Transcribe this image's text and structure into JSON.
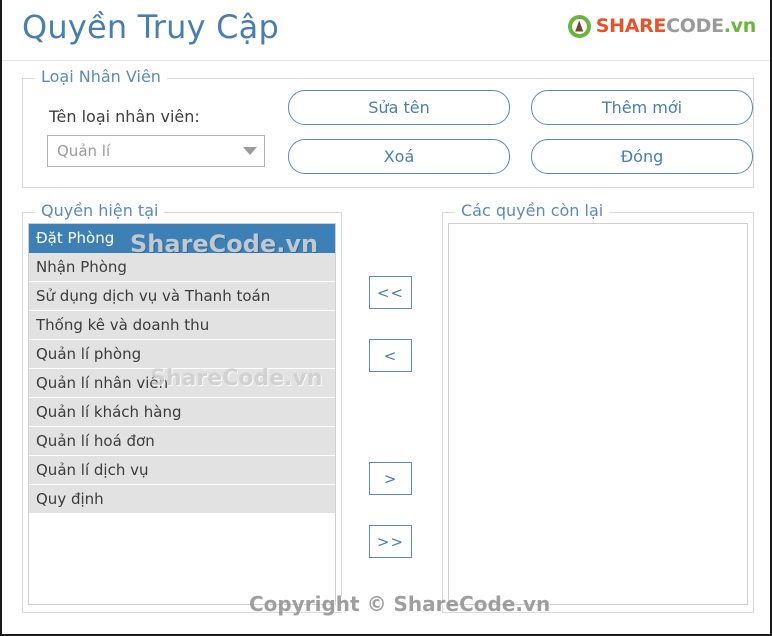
{
  "window": {
    "title": "Quyền Truy Cập"
  },
  "logo": {
    "mark": "sharecode-leaf-icon",
    "share": "SHARE",
    "code": "CODE",
    "vn": ".vn",
    "green": "#6cb33f",
    "orange": "#e8532b",
    "gray": "#9a9a9a"
  },
  "employee_type_group": {
    "legend": "Loại Nhân Viên",
    "label": "Tên loại nhân viên:",
    "combo": {
      "value": "Quản lí",
      "arrow": "chevron-down-icon"
    },
    "buttons": {
      "edit_name": "Sửa tên",
      "add_new": "Thêm mới",
      "delete": "Xoá",
      "close": "Đóng"
    }
  },
  "current_permissions": {
    "legend": "Quyền hiện tại",
    "selected_index": 0,
    "items": [
      "Đặt Phòng",
      "Nhận Phòng",
      "Sử dụng dịch vụ và Thanh toán",
      "Thống kê và doanh thu",
      "Quản lí phòng",
      "Quản lí nhân viên",
      "Quản lí khách hàng",
      "Quản lí hoá đơn",
      "Quản lí dịch vụ",
      "Quy định"
    ]
  },
  "remaining_permissions": {
    "legend": "Các quyền còn lại",
    "items": []
  },
  "transfer_buttons": {
    "all_left": "<<",
    "one_left": "<",
    "one_right": ">",
    "all_right": ">>"
  },
  "watermarks": {
    "list_top": "ShareCode.vn",
    "list_middle": "ShareCode.vn",
    "footer": "Copyright © ShareCode.vn"
  },
  "colors": {
    "title_blue": "#4a7fad",
    "accent_blue": "#5b8cb8",
    "selection_blue": "#3d80b6",
    "list_row_gray": "#e2e2e2"
  }
}
